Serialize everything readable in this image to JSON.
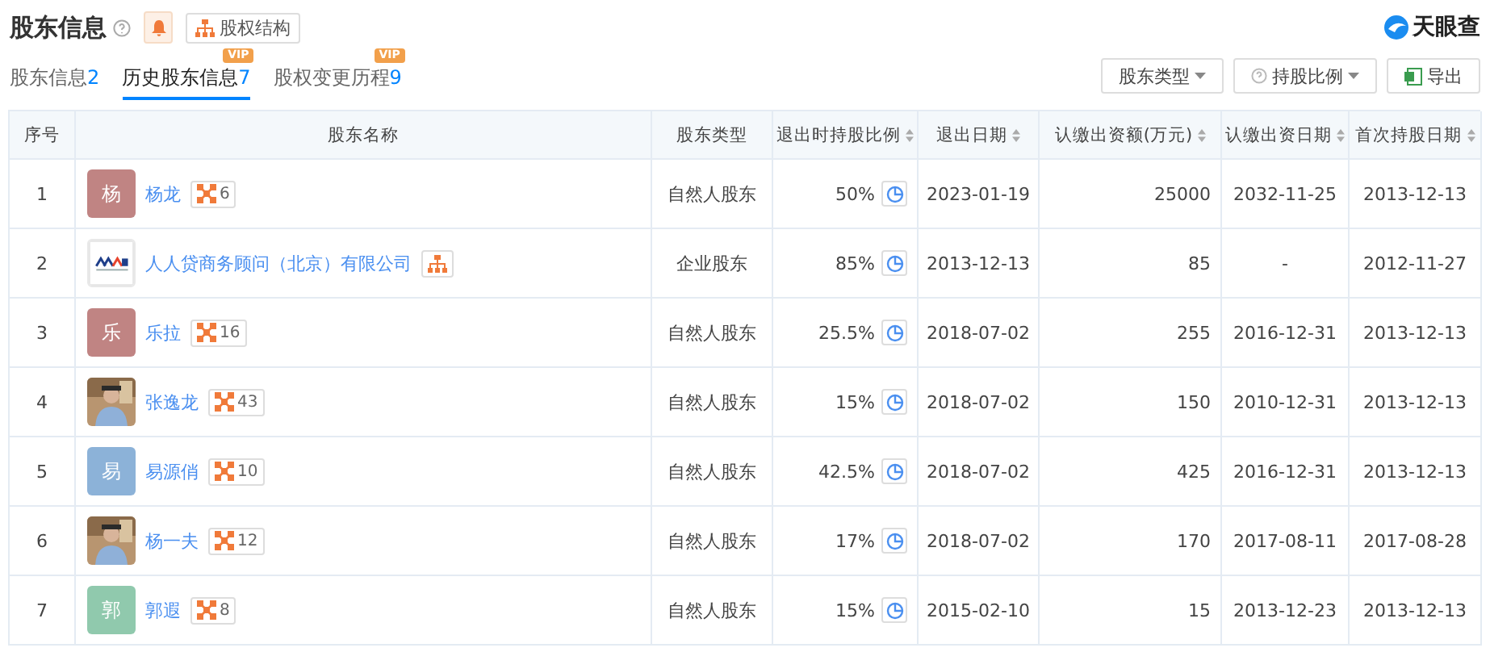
{
  "header": {
    "title": "股东信息",
    "structure_button": "股权结构",
    "brand": "天眼查"
  },
  "tabs": [
    {
      "label": "股东信息",
      "count": "2",
      "selected": false
    },
    {
      "label": "历史股东信息",
      "count": "7",
      "selected": true,
      "badge": "VIP"
    },
    {
      "label": "股权变更历程",
      "count": "9",
      "selected": false,
      "badge": "VIP"
    }
  ],
  "filters": [
    {
      "label": "股东类型",
      "kind": "dropdown"
    },
    {
      "label": "持股比例",
      "kind": "help-dropdown"
    },
    {
      "label": "导出",
      "kind": "export"
    }
  ],
  "table": {
    "columns": [
      {
        "label": "序号",
        "sortable": false
      },
      {
        "label": "股东名称",
        "sortable": false
      },
      {
        "label": "股东类型",
        "sortable": false
      },
      {
        "label": "退出时持股比例",
        "sortable": true
      },
      {
        "label": "退出日期",
        "sortable": true
      },
      {
        "label": "认缴出资额(万元)",
        "sortable": true
      },
      {
        "label": "认缴出资日期",
        "sortable": true
      },
      {
        "label": "首次持股日期",
        "sortable": true
      }
    ],
    "rows": [
      {
        "index": "1",
        "avatar": {
          "kind": "letter",
          "text": "杨",
          "color": "#c08483"
        },
        "name": "杨龙",
        "relations": "6",
        "type": "自然人股东",
        "ratio": "50%",
        "exit_date": "2023-01-19",
        "amount": "25000",
        "subscribe_date": "2032-11-25",
        "first_date": "2013-12-13"
      },
      {
        "index": "2",
        "avatar": {
          "kind": "logo"
        },
        "name": "人人贷商务顾问（北京）有限公司",
        "type": "企业股东",
        "ratio": "85%",
        "exit_date": "2013-12-13",
        "amount": "85",
        "subscribe_date": "-",
        "first_date": "2012-11-27"
      },
      {
        "index": "3",
        "avatar": {
          "kind": "letter",
          "text": "乐",
          "color": "#c08483"
        },
        "name": "乐拉",
        "relations": "16",
        "type": "自然人股东",
        "ratio": "25.5%",
        "exit_date": "2018-07-02",
        "amount": "255",
        "subscribe_date": "2016-12-31",
        "first_date": "2013-12-13"
      },
      {
        "index": "4",
        "name": "张逸龙",
        "relations": "43",
        "type": "自然人股东",
        "ratio": "15%",
        "exit_date": "2018-07-02",
        "amount": "150",
        "subscribe_date": "2010-12-31",
        "first_date": "2013-12-13"
      },
      {
        "index": "5",
        "avatar": {
          "kind": "letter",
          "text": "易",
          "color": "#8cb2d8"
        },
        "name": "易源俏",
        "relations": "10",
        "type": "自然人股东",
        "ratio": "42.5%",
        "exit_date": "2018-07-02",
        "amount": "425",
        "subscribe_date": "2016-12-31",
        "first_date": "2013-12-13"
      },
      {
        "index": "6",
        "name": "杨一夫",
        "relations": "12",
        "type": "自然人股东",
        "ratio": "17%",
        "exit_date": "2018-07-02",
        "amount": "170",
        "subscribe_date": "2017-08-11",
        "first_date": "2017-08-28"
      },
      {
        "index": "7",
        "avatar": {
          "kind": "letter",
          "text": "郭",
          "color": "#90c9ad"
        },
        "name": "郭遐",
        "relations": "8",
        "type": "自然人股东",
        "ratio": "15%",
        "exit_date": "2015-02-10",
        "amount": "15",
        "subscribe_date": "2013-12-23",
        "first_date": "2013-12-13"
      }
    ]
  }
}
